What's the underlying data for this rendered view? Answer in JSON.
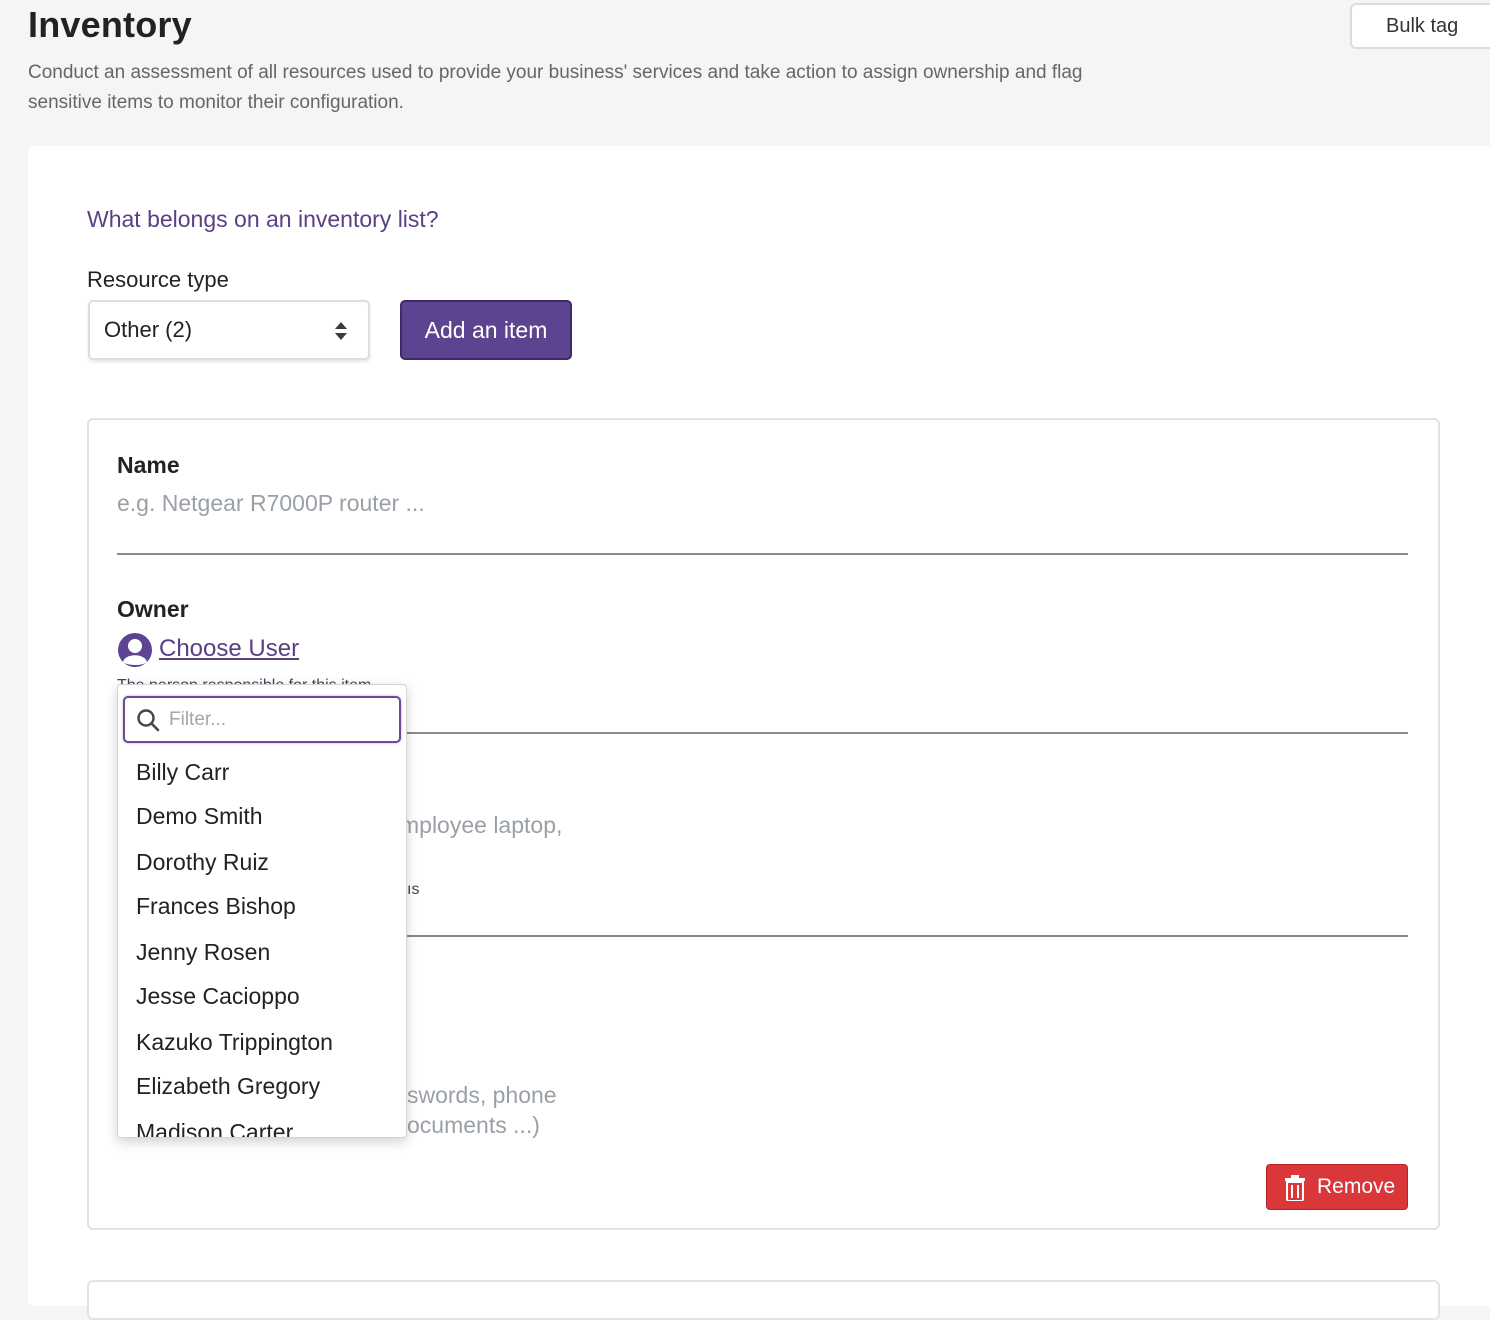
{
  "header": {
    "title": "Inventory",
    "description": "Conduct an assessment of all resources used to provide your business' services and take action to assign ownership and flag sensitive items to monitor their configuration.",
    "bulk_tag_label": "Bulk tag"
  },
  "main": {
    "help_link": "What belongs on an inventory list?",
    "resource_type": {
      "label": "Resource type",
      "selected": "Other (2)"
    },
    "add_item_label": "Add an item"
  },
  "item": {
    "name": {
      "label": "Name",
      "placeholder": "e.g. Netgear R7000P router ..."
    },
    "owner": {
      "label": "Owner",
      "choose_user_label": "Choose User",
      "hint": "The person responsible for this item"
    },
    "obscured_text": {
      "line1": "mployee laptop,",
      "line2": "ıs",
      "line3": "swords, phone",
      "line4": "ocuments ...)"
    },
    "remove_label": "Remove"
  },
  "user_dropdown": {
    "filter_placeholder": "Filter...",
    "users": [
      "Billy Carr",
      "Demo Smith",
      "Dorothy Ruiz",
      "Frances Bishop",
      "Jenny Rosen",
      "Jesse Cacioppo",
      "Kazuko Trippington",
      "Elizabeth Gregory",
      "Madison Carter"
    ]
  },
  "colors": {
    "brand_purple": "#5d4390",
    "link_purple": "#5b3f85",
    "danger_red": "#d9373a",
    "page_background": "#f5f5f5"
  },
  "icons": {
    "resource_select": "sort-arrows-icon",
    "choose_user": "user-avatar-icon",
    "remove": "trash-icon",
    "filter": "search-icon"
  }
}
